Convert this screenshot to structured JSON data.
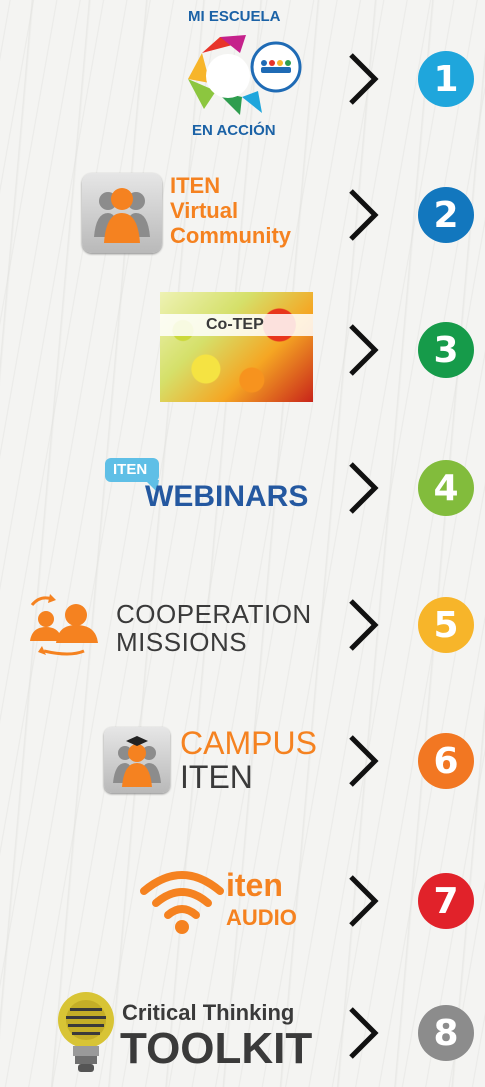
{
  "items": [
    {
      "number": "1",
      "color": "#1fa6dc",
      "lines": [
        "MI ESCUELA",
        "EN ACCIÓN"
      ]
    },
    {
      "number": "2",
      "color": "#1277be",
      "lines": [
        "ITEN",
        "Virtual",
        "Community"
      ]
    },
    {
      "number": "3",
      "color": "#169b4a",
      "lines": [
        "Co-TEP"
      ]
    },
    {
      "number": "4",
      "color": "#82bc3c",
      "lines": [
        "ITEN",
        "WEBINARS"
      ]
    },
    {
      "number": "5",
      "color": "#f7b52a",
      "lines": [
        "COOPERATION",
        "MISSIONS"
      ]
    },
    {
      "number": "6",
      "color": "#f27722",
      "lines": [
        "CAMPUS",
        "ITEN"
      ]
    },
    {
      "number": "7",
      "color": "#e1222a",
      "lines": [
        "iten",
        "AUDIO"
      ]
    },
    {
      "number": "8",
      "color": "#8c8c8c",
      "lines": [
        "Critical Thinking",
        "TOOLKIT"
      ]
    }
  ],
  "icons": {
    "chevron": "chevron-right-icon",
    "user_group": "user-group-icon",
    "wifi": "wifi-icon",
    "lightbulb": "lightbulb-icon"
  },
  "colors": {
    "orange": "#f58220",
    "navy": "#2458a0",
    "dark_gray": "#3a3a3a"
  }
}
